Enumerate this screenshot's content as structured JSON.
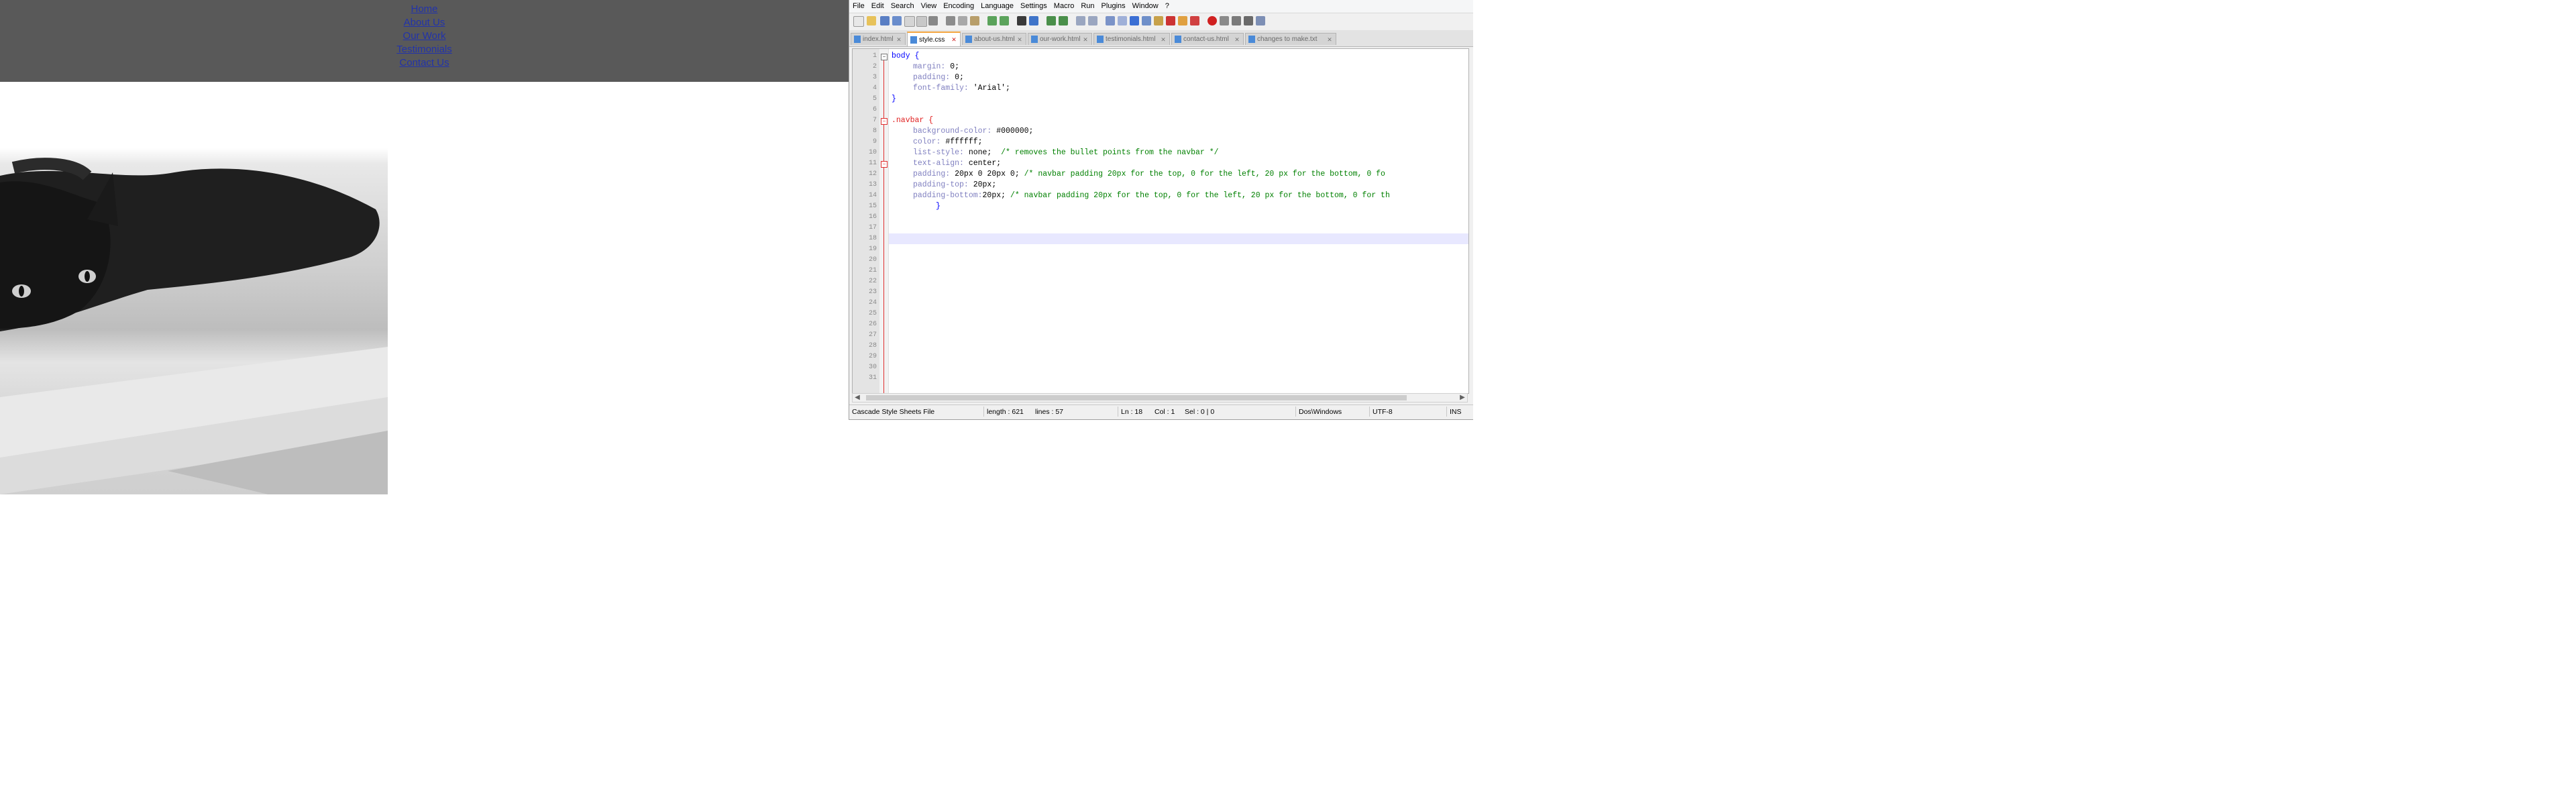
{
  "website": {
    "nav_links": [
      "Home",
      "About Us",
      "Our Work",
      "Testimonials",
      "Contact Us"
    ],
    "colors": {
      "navbar_bg": "#595959",
      "link": "#2233aa"
    }
  },
  "editor_app": {
    "menu": [
      "File",
      "Edit",
      "Search",
      "View",
      "Encoding",
      "Language",
      "Settings",
      "Macro",
      "Run",
      "Plugins",
      "Window",
      "?"
    ],
    "tabs": [
      {
        "label": "index.html",
        "active": false
      },
      {
        "label": "style.css",
        "active": true
      },
      {
        "label": "about-us.html",
        "active": false
      },
      {
        "label": "our-work.html",
        "active": false
      },
      {
        "label": "testimonials.html",
        "active": false
      },
      {
        "label": "contact-us.html",
        "active": false
      },
      {
        "label": "changes to make.txt",
        "active": false
      }
    ],
    "code_lines": [
      "1",
      "2",
      "3",
      "4",
      "5",
      "6",
      "7",
      "8",
      "9",
      "10",
      "11",
      "12",
      "13",
      "14",
      "15",
      "16",
      "17",
      "18",
      "19",
      "20",
      "21",
      "22",
      "23",
      "24",
      "25",
      "26",
      "27",
      "28",
      "29",
      "30",
      "31"
    ],
    "code": {
      "l1_sel": "body {",
      "l2_prop": "margin:",
      "l2_val": " 0;",
      "l3_prop": "padding:",
      "l3_val": " 0;",
      "l4_prop": "font-family:",
      "l4_val": " 'Arial';",
      "l5": "}",
      "l7_sel": ".navbar {",
      "l8_prop": "background-color:",
      "l8_val": " #000000;",
      "l9_prop": "color:",
      "l9_val": " #ffffff;",
      "l10_prop": "list-style:",
      "l10_val": " none;",
      "l10_cm": "  /* removes the bullet points from the navbar */",
      "l11_prop": "text-align:",
      "l11_val": " center;",
      "l12_prop": "padding:",
      "l12_val": " 20px 0 20px 0;",
      "l12_cm": " /* navbar padding 20px for the top, 0 for the left, 20 px for the bottom, 0 fo",
      "l13_prop": "padding-top:",
      "l13_val": " 20px;",
      "l14_prop": "padding-bottom:",
      "l14_val": "20px;",
      "l14_cm": " /* navbar padding 20px for the top, 0 for the left, 20 px for the bottom, 0 for th",
      "l15": "}"
    },
    "status": {
      "file_type": "Cascade Style Sheets File",
      "length": "length : 621",
      "lines": "lines : 57",
      "ln": "Ln : 18",
      "col": "Col : 1",
      "sel": "Sel : 0 | 0",
      "eol": "Dos\\Windows",
      "encoding": "UTF-8",
      "mode": "INS"
    },
    "colors": {
      "active_tab_accent": "#f5a742",
      "fold_line": "#e03030",
      "selector": "#0000ff",
      "comment": "#008000"
    }
  }
}
